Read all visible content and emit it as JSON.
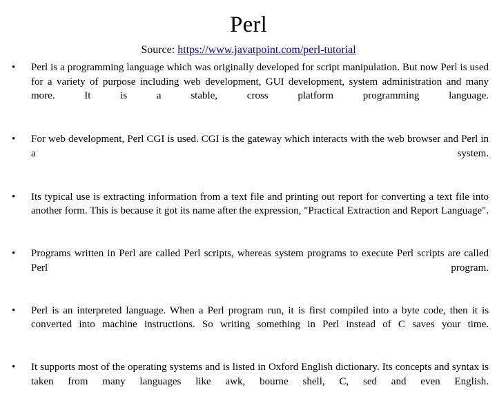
{
  "slide": {
    "title": "Perl",
    "source": {
      "label": "Source:",
      "url_text": "https://www.javatpoint.com/perl-tutorial",
      "link_color": "#000099"
    },
    "bullet_marker": "•",
    "bullets": [
      {
        "id": "bullet-overview",
        "text": "Perl is a programming language which was originally developed for script manipulation. But now Perl is used for a variety of purpose including web development, GUI development, system administration and many more. It is a stable, cross platform programming language."
      },
      {
        "id": "bullet-web-development",
        "text": "For web development, Perl CGI is used. CGI is the gateway which interacts with the web browser and Perl in a system."
      },
      {
        "id": "bullet-typical-use",
        "text": "Its typical use is extracting information from a text file and printing out report for converting a text file into another form. This is because it got its name after the expression, \"Practical Extraction and Report Language\"."
      },
      {
        "id": "bullet-scripts-vs-programs",
        "text": "Programs written in Perl are called Perl scripts, whereas system programs to execute Perl scripts are called Perl program."
      },
      {
        "id": "bullet-interpreted",
        "text": "Perl is an interpreted language. When a Perl program run, it is first compiled into a byte code, then it is converted into machine instructions. So writing something in Perl instead of C saves your time."
      },
      {
        "id": "bullet-portability",
        "text": "It supports most of the operating systems and is listed in Oxford English dictionary. Its concepts and syntax is taken from many languages like awk, bourne shell, C, sed and even English."
      }
    ]
  }
}
